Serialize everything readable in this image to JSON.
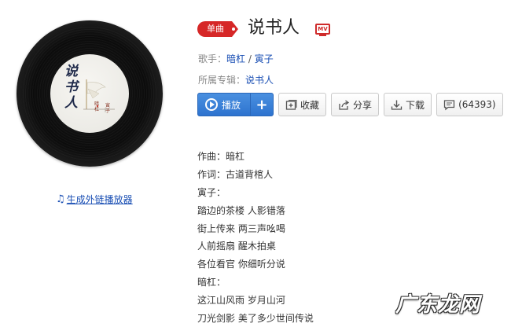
{
  "album_cover": {
    "title_text": "说书人",
    "sub_text_left": "暗杠",
    "sub_text_right": "寅子"
  },
  "player_link": {
    "label": "生成外链播放器",
    "icon": "music-note-icon"
  },
  "header": {
    "tag_label": "单曲",
    "song_title": "说书人",
    "mv_label": "MV"
  },
  "meta": {
    "singer_label": "歌手：",
    "singers": [
      "暗杠",
      "寅子"
    ],
    "singer_sep": "/",
    "album_label": "所属专辑：",
    "album": "说书人"
  },
  "buttons": {
    "play": "播放",
    "add": "+",
    "collect": "收藏",
    "share": "分享",
    "download": "下载",
    "comments": "(64393)"
  },
  "lyrics": [
    "作曲：暗杠",
    "作词：古道背棺人",
    "寅子：",
    "踏边的茶楼 人影错落",
    "街上传来 两三声吆喝",
    "人前摇扇 醒木拍桌",
    "各位看官 你细听分说",
    "暗杠：",
    "这江山风雨 岁月山河",
    "刀光剑影 美了多少世间传说"
  ],
  "watermark": "广东龙网",
  "colors": {
    "accent_red": "#d62727",
    "link_blue": "#1a4fb4",
    "play_blue": "#2e73cf"
  }
}
